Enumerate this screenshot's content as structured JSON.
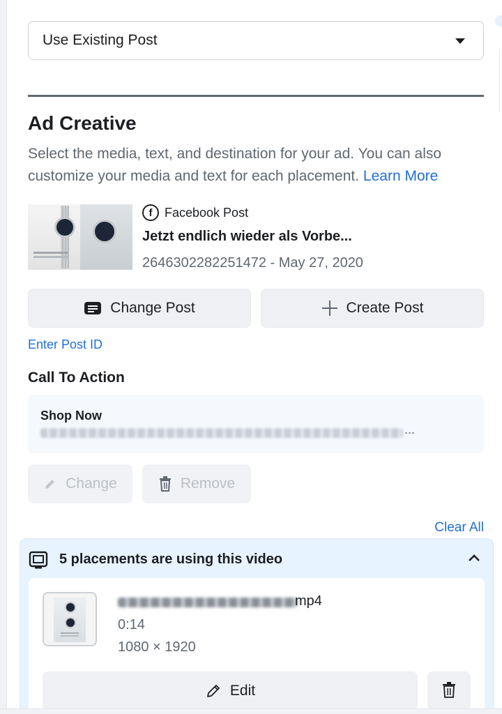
{
  "post_source": {
    "selected": "Use Existing Post"
  },
  "ad_creative": {
    "title": "Ad Creative",
    "description": "Select the media, text, and destination for your ad. You can also customize your media and text for each placement.",
    "learn_more": "Learn More"
  },
  "post": {
    "source_label": "Facebook Post",
    "title": "Jetzt endlich wieder als Vorbe...",
    "meta": "2646302282251472 - May 27, 2020"
  },
  "actions": {
    "change_post": "Change Post",
    "create_post": "Create Post",
    "enter_post_id": "Enter Post ID"
  },
  "call_to_action": {
    "title": "Call To Action",
    "label": "Shop Now",
    "url_ellipsis": "...",
    "change": "Change",
    "remove": "Remove"
  },
  "placements": {
    "clear_all": "Clear All",
    "header": "5 placements are using this video",
    "file_ext": "mp4",
    "duration": "0:14",
    "dimensions": "1080 × 1920",
    "edit": "Edit"
  },
  "colors": {
    "link": "#216fdb",
    "panel_bg": "#e7f3ff",
    "button_bg": "#eef0f3"
  }
}
